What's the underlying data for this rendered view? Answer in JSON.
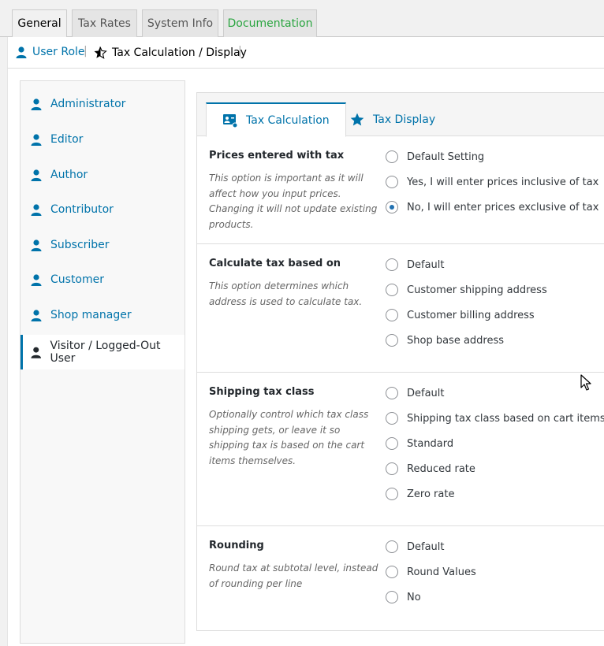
{
  "nav_tabs": [
    {
      "label": "General",
      "active": true
    },
    {
      "label": "Tax Rates",
      "active": false
    },
    {
      "label": "System Info",
      "active": false
    },
    {
      "label": "Documentation",
      "active": false
    }
  ],
  "subnav": {
    "user_role": "User Role",
    "separator": "|",
    "tax_calc_display": "Tax Calculation / Display"
  },
  "roles": [
    {
      "label": "Administrator",
      "icon": "user-icon"
    },
    {
      "label": "Editor",
      "icon": "user-icon"
    },
    {
      "label": "Author",
      "icon": "user-icon"
    },
    {
      "label": "Contributor",
      "icon": "user-icon"
    },
    {
      "label": "Subscriber",
      "icon": "user-icon"
    },
    {
      "label": "Customer",
      "icon": "user-icon"
    },
    {
      "label": "Shop manager",
      "icon": "user-icon"
    },
    {
      "label": "Visitor / Logged-Out User",
      "icon": "user-icon",
      "active": true
    }
  ],
  "panel_tabs": [
    {
      "label": "Tax Calculation",
      "icon": "calculator-icon",
      "active": true
    },
    {
      "label": "Tax Display",
      "icon": "star-icon",
      "active": false
    }
  ],
  "sections": [
    {
      "title": "Prices entered with tax",
      "description": "This option is important as it will affect how you input prices. Changing it will not update existing products.",
      "options": [
        {
          "label": "Default Setting",
          "checked": false
        },
        {
          "label": "Yes, I will enter prices inclusive of tax",
          "checked": false
        },
        {
          "label": "No, I will enter prices exclusive of tax",
          "checked": true
        }
      ]
    },
    {
      "title": "Calculate tax based on",
      "description": "This option determines which address is used to calculate tax.",
      "options": [
        {
          "label": "Default",
          "checked": false
        },
        {
          "label": "Customer shipping address",
          "checked": false
        },
        {
          "label": "Customer billing address",
          "checked": false
        },
        {
          "label": "Shop base address",
          "checked": false
        }
      ]
    },
    {
      "title": "Shipping tax class",
      "description": "Optionally control which tax class shipping gets, or leave it so shipping tax is based on the cart items themselves.",
      "options": [
        {
          "label": "Default",
          "checked": false
        },
        {
          "label": "Shipping tax class based on cart items",
          "checked": false
        },
        {
          "label": "Standard",
          "checked": false
        },
        {
          "label": "Reduced rate",
          "checked": false
        },
        {
          "label": "Zero rate",
          "checked": false
        }
      ]
    },
    {
      "title": "Rounding",
      "description": "Round tax at subtotal level, instead of rounding per line",
      "options": [
        {
          "label": "Default",
          "checked": false
        },
        {
          "label": "Round Values",
          "checked": false
        },
        {
          "label": "No",
          "checked": false
        }
      ]
    }
  ],
  "colors": {
    "accent": "#0073aa",
    "doc_tab": "#2aa540"
  }
}
